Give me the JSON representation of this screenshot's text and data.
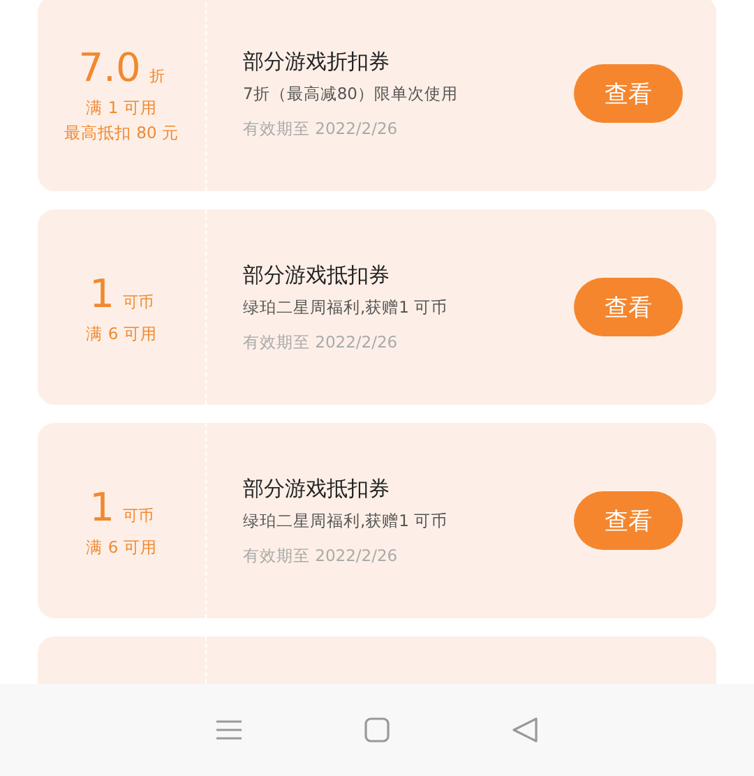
{
  "coupons": [
    {
      "kind": "coupon",
      "value": "7.0",
      "unit": "折",
      "conditions": [
        "满 1 可用",
        "最高抵扣 80 元"
      ],
      "title": "部分游戏折扣券",
      "description": "7折（最高减80）限单次使用",
      "validity": "有效期至 2022/2/26",
      "button": "查看"
    },
    {
      "kind": "coupon",
      "value": "1",
      "unit": "可币",
      "conditions": [
        "满 6 可用"
      ],
      "title": "部分游戏抵扣券",
      "description": "绿珀二星周福利,获赠1 可币",
      "validity": "有效期至 2022/2/26",
      "button": "查看"
    },
    {
      "kind": "coupon",
      "value": "1",
      "unit": "可币",
      "conditions": [
        "满 6 可用"
      ],
      "title": "部分游戏抵扣券",
      "description": "绿珀二星周福利,获赠1 可币",
      "validity": "有效期至 2022/2/26",
      "button": "查看"
    },
    {
      "kind": "cut"
    }
  ]
}
